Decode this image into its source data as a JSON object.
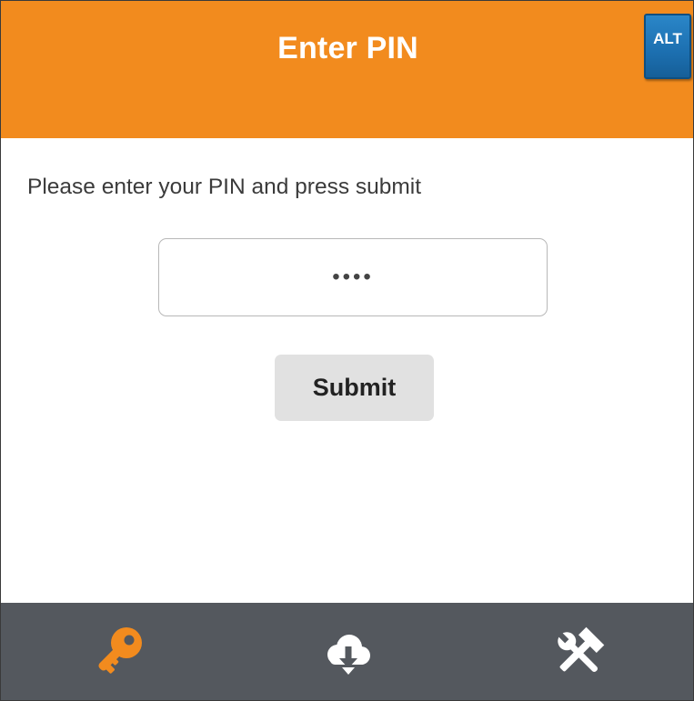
{
  "header": {
    "title": "Enter PIN",
    "alt_badge": "ALT"
  },
  "main": {
    "instruction": "Please enter your PIN and press submit",
    "pin_value": "••••",
    "submit_label": "Submit"
  },
  "tabbar": {
    "tabs": [
      {
        "icon": "key-icon",
        "active": true
      },
      {
        "icon": "cloud-download-icon",
        "active": false
      },
      {
        "icon": "tools-icon",
        "active": false
      }
    ]
  },
  "colors": {
    "header_bg": "#f28b1e",
    "tabbar_bg": "#54585e",
    "active_icon": "#f28b1e",
    "inactive_icon": "#ffffff",
    "alt_badge_bg": "#1c6fb0"
  }
}
